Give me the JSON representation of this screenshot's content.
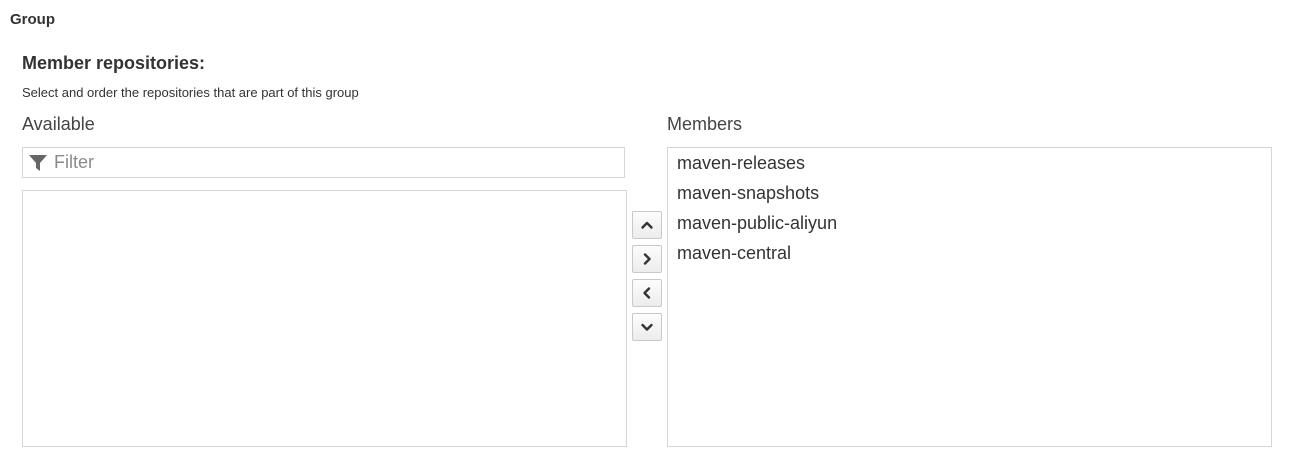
{
  "section": {
    "title": "Group"
  },
  "field": {
    "title": "Member repositories:",
    "help": "Select and order the repositories that are part of this group"
  },
  "available": {
    "label": "Available",
    "filter_placeholder": "Filter",
    "filter_icon": "filter-icon",
    "items": []
  },
  "members": {
    "label": "Members",
    "items": [
      {
        "label": "maven-releases"
      },
      {
        "label": "maven-snapshots"
      },
      {
        "label": "maven-public-aliyun"
      },
      {
        "label": "maven-central"
      }
    ]
  },
  "buttons": [
    {
      "name": "move-up-button",
      "icon": "chevron-up-icon"
    },
    {
      "name": "move-right-button",
      "icon": "chevron-right-icon"
    },
    {
      "name": "move-left-button",
      "icon": "chevron-left-icon"
    },
    {
      "name": "move-down-button",
      "icon": "chevron-down-icon"
    }
  ]
}
